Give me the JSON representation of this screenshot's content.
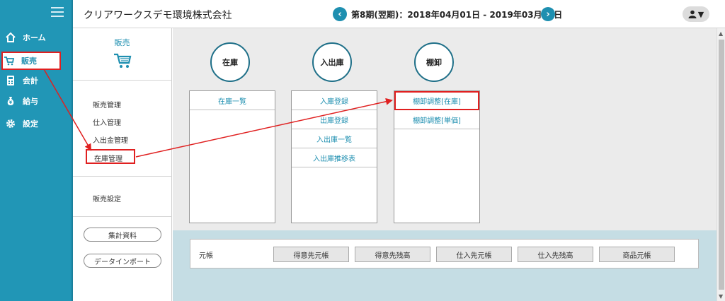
{
  "header": {
    "company": "クリアワークスデモ環境株式会社",
    "period": "第8期(翌期)：2018年04月01日 - 2019年03月31日"
  },
  "nav": {
    "items": [
      {
        "label": "ホーム"
      },
      {
        "label": "販売"
      },
      {
        "label": "会計"
      },
      {
        "label": "給与"
      },
      {
        "label": "設定"
      }
    ]
  },
  "submenu": {
    "title": "販売",
    "links": [
      "販売管理",
      "仕入管理",
      "入出金管理",
      "在庫管理"
    ],
    "settings": "販売設定",
    "buttons": [
      "集計資料",
      "データインポート"
    ]
  },
  "sections": [
    {
      "title": "在庫",
      "items": [
        "在庫一覧"
      ]
    },
    {
      "title": "入出庫",
      "items": [
        "入庫登録",
        "出庫登録",
        "入出庫一覧",
        "入出庫推移表"
      ]
    },
    {
      "title": "棚卸",
      "items": [
        "棚卸調整[在庫]",
        "棚卸調整[単価]"
      ]
    }
  ],
  "ledger": {
    "label": "元帳",
    "buttons": [
      "得意先元帳",
      "得意先残高",
      "仕入先元帳",
      "仕入先残高",
      "商品元帳"
    ]
  },
  "colors": {
    "nav_bg": "#2196b6",
    "accent": "#1e8fb0",
    "highlight": "#e02020",
    "main_bg": "#ebebeb",
    "lower_bg": "#c5dde4"
  }
}
